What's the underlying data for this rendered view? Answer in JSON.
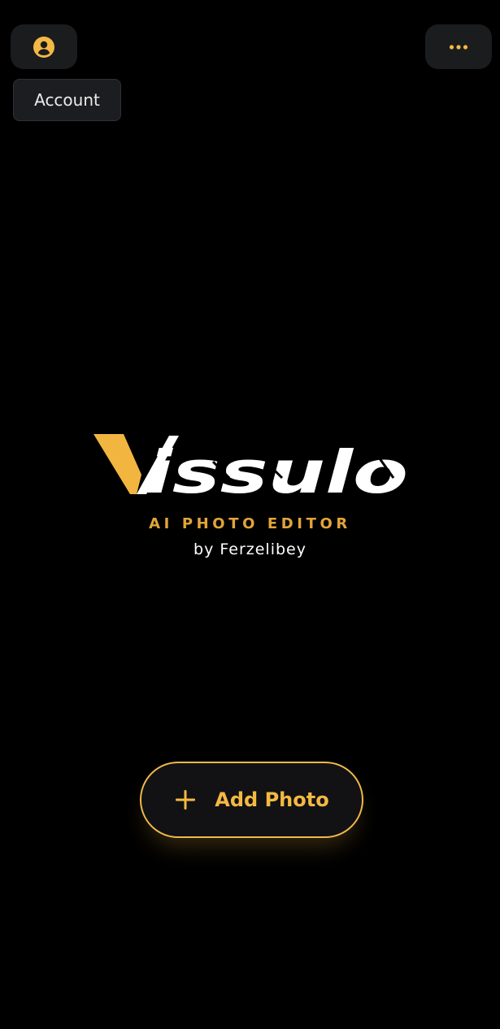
{
  "header": {
    "account_icon": "person-circle-icon",
    "more_icon": "more-horizontal-icon",
    "tooltip_label": "Account"
  },
  "brand": {
    "name": "Vissulo",
    "tagline": "AI PHOTO EDITOR",
    "byline": "by Ferzelibey"
  },
  "actions": {
    "add_photo_label": "Add Photo",
    "add_photo_icon": "plus-icon"
  },
  "colors": {
    "accent": "#f4b943",
    "background": "#000000",
    "surface": "#1b1c1e"
  }
}
